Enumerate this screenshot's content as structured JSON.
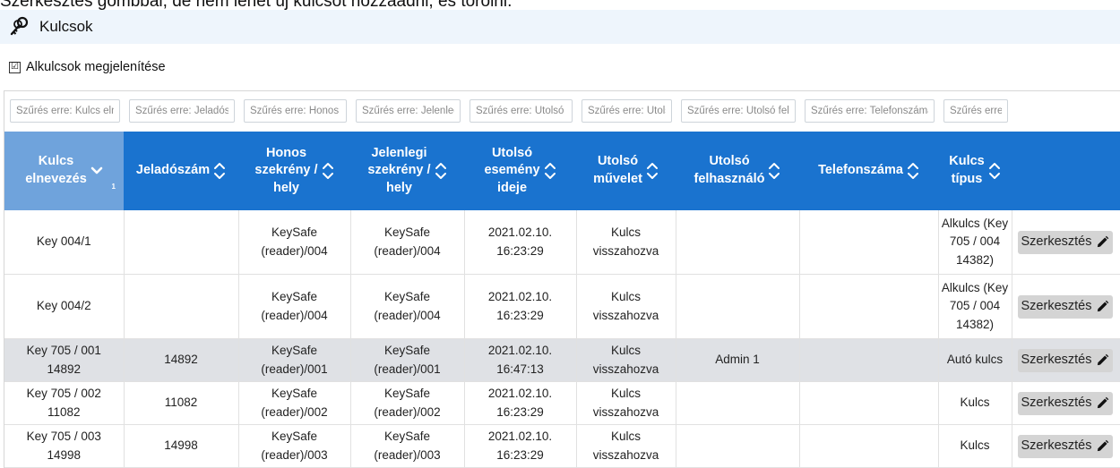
{
  "top_note": "Szerkesztés gombbal, de nem lehet új kulcsot hozzáadni, és törölni.",
  "window": {
    "title": "Kulcsok",
    "icon": "keys-icon"
  },
  "options": {
    "checkbox_mark": "☑",
    "show_subkeys_label": "Alkulcsok megjelenítése",
    "show_subkeys_checked": true
  },
  "table": {
    "filters": [
      "Szűrés erre: Kulcs elnevezés",
      "Szűrés erre: Jeladószám",
      "Szűrés erre: Honos szekrény / hely",
      "Szűrés erre: Jelenlegi szekrény / hely",
      "Szűrés erre: Utolsó esemény ideje",
      "Szűrés erre: Utolsó művelet",
      "Szűrés erre: Utolsó felhasználó",
      "Szűrés erre: Telefonszáma",
      "Szűrés erre: Kulcs típus"
    ],
    "columns": [
      {
        "line1": "Kulcs",
        "line2": "elnevezés",
        "line3": "",
        "sorted": true,
        "sort_index": "1"
      },
      {
        "line1": "Jeladószám",
        "line2": "",
        "line3": ""
      },
      {
        "line1": "Honos",
        "line2": "szekrény /",
        "line3": "hely"
      },
      {
        "line1": "Jelenlegi",
        "line2": "szekrény /",
        "line3": "hely"
      },
      {
        "line1": "Utolsó",
        "line2": "esemény",
        "line3": "ideje"
      },
      {
        "line1": "Utolsó",
        "line2": "művelet",
        "line3": ""
      },
      {
        "line1": "Utolsó",
        "line2": "felhasználó",
        "line3": ""
      },
      {
        "line1": "Telefonszáma",
        "line2": "",
        "line3": ""
      },
      {
        "line1": "Kulcs",
        "line2": "típus",
        "line3": ""
      }
    ],
    "edit_label": "Szerkesztés",
    "rows": [
      {
        "name": [
          "Key 004/1"
        ],
        "transmitter": "",
        "home": [
          "KeySafe",
          "(reader)/004"
        ],
        "current": [
          "KeySafe",
          "(reader)/004"
        ],
        "time": [
          "2021.02.10.",
          "16:23:29"
        ],
        "action": [
          "Kulcs",
          "visszahozva"
        ],
        "user": "",
        "phone": "",
        "type": [
          "Alkulcs (Key",
          "705 / 004",
          "14382)"
        ],
        "size": "tall",
        "highlight": false
      },
      {
        "name": [
          "Key 004/2"
        ],
        "transmitter": "",
        "home": [
          "KeySafe",
          "(reader)/004"
        ],
        "current": [
          "KeySafe",
          "(reader)/004"
        ],
        "time": [
          "2021.02.10.",
          "16:23:29"
        ],
        "action": [
          "Kulcs",
          "visszahozva"
        ],
        "user": "",
        "phone": "",
        "type": [
          "Alkulcs (Key",
          "705 / 004",
          "14382)"
        ],
        "size": "tall",
        "highlight": false
      },
      {
        "name": [
          "Key 705 / 001",
          "14892"
        ],
        "transmitter": "14892",
        "home": [
          "KeySafe",
          "(reader)/001"
        ],
        "current": [
          "KeySafe",
          "(reader)/001"
        ],
        "time": [
          "2021.02.10.",
          "16:47:13"
        ],
        "action": [
          "Kulcs",
          "visszahozva"
        ],
        "user": "Admin 1",
        "phone": "",
        "type": [
          "Autó kulcs"
        ],
        "size": "short",
        "highlight": true
      },
      {
        "name": [
          "Key 705 / 002",
          "11082"
        ],
        "transmitter": "11082",
        "home": [
          "KeySafe",
          "(reader)/002"
        ],
        "current": [
          "KeySafe",
          "(reader)/002"
        ],
        "time": [
          "2021.02.10.",
          "16:23:29"
        ],
        "action": [
          "Kulcs",
          "visszahozva"
        ],
        "user": "",
        "phone": "",
        "type": [
          "Kulcs"
        ],
        "size": "short",
        "highlight": false
      },
      {
        "name": [
          "Key 705 / 003",
          "14998"
        ],
        "transmitter": "14998",
        "home": [
          "KeySafe",
          "(reader)/003"
        ],
        "current": [
          "KeySafe",
          "(reader)/003"
        ],
        "time": [
          "2021.02.10.",
          "16:23:29"
        ],
        "action": [
          "Kulcs",
          "visszahozva"
        ],
        "user": "",
        "phone": "",
        "type": [
          "Kulcs"
        ],
        "size": "short",
        "highlight": false
      }
    ]
  },
  "colors": {
    "header_bg": "#1a73cf",
    "sorted_header_bg": "#6fa3dc",
    "title_bar_bg": "#eef5fc",
    "highlight_row_bg": "#dfe1e5"
  }
}
